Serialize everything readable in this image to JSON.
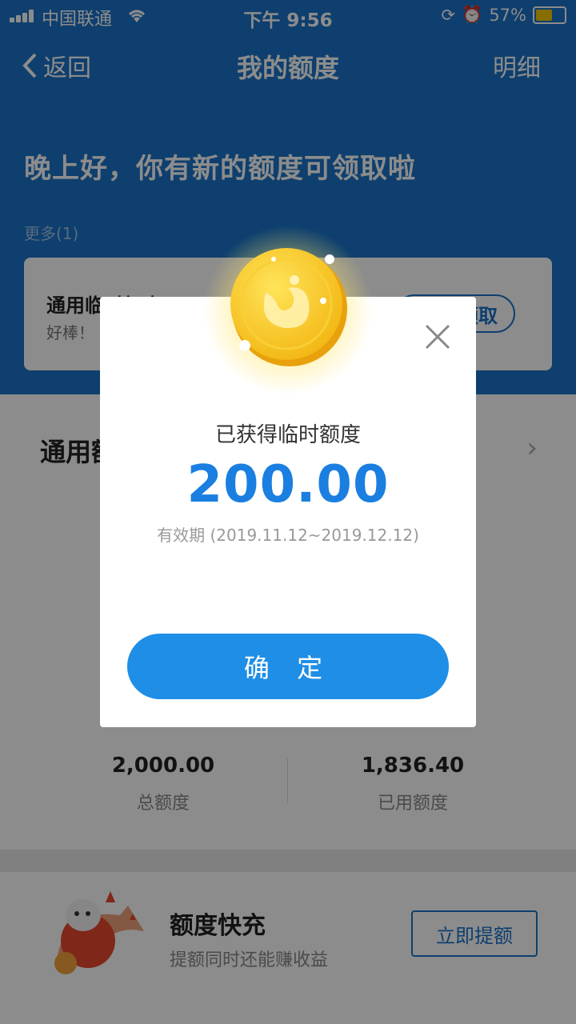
{
  "status_bar": {
    "carrier": "中国联通",
    "time": "下午 9:56",
    "battery": "57%"
  },
  "nav": {
    "back_label": "返回",
    "title": "我的额度",
    "detail_label": "明细"
  },
  "greeting": "晚上好，你有新的额度可领取啦",
  "more_label": "更多(1)",
  "offer_card": {
    "title": "通用临时额度200元",
    "subtitle": "好棒！",
    "button": "领取"
  },
  "general_section": {
    "title": "通用额度"
  },
  "stats": [
    {
      "value": "2,000.00",
      "label": "总额度"
    },
    {
      "value": "1,836.40",
      "label": "已用额度"
    }
  ],
  "promo": {
    "title": "额度快充",
    "subtitle": "提额同时还能赚收益",
    "button": "立即提额"
  },
  "dialog": {
    "title": "已获得临时额度",
    "amount": "200.00",
    "valid": "有效期 (2019.11.12~2019.12.12)",
    "confirm": "确 定"
  },
  "colors": {
    "primary": "#1a73c9",
    "button": "#1f8ee6",
    "coin": "#f7c61b"
  }
}
